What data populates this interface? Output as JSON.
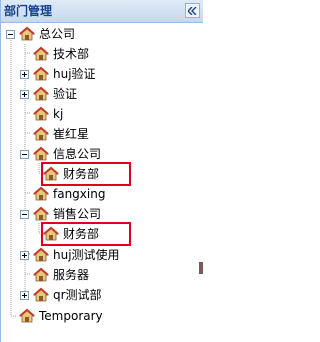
{
  "panel": {
    "title": "部门管理"
  },
  "tree": {
    "root": "总公司",
    "n1": "技术部",
    "n2": "huj验证",
    "n3": "验证",
    "n4": "kj",
    "n5": "崔红星",
    "n6": "信息公司",
    "n6a": "财务部",
    "n7": "fangxing",
    "n8": "销售公司",
    "n8a": "财务部",
    "n9": "huj测试使用",
    "n10": "服务器",
    "n11": "qr测试部",
    "temp": "Temporary"
  },
  "icons": {
    "collapse": "double-chevron-left-icon",
    "node": "house-icon"
  },
  "colors": {
    "header_text": "#15428b",
    "highlight_box": "#e0001a"
  }
}
